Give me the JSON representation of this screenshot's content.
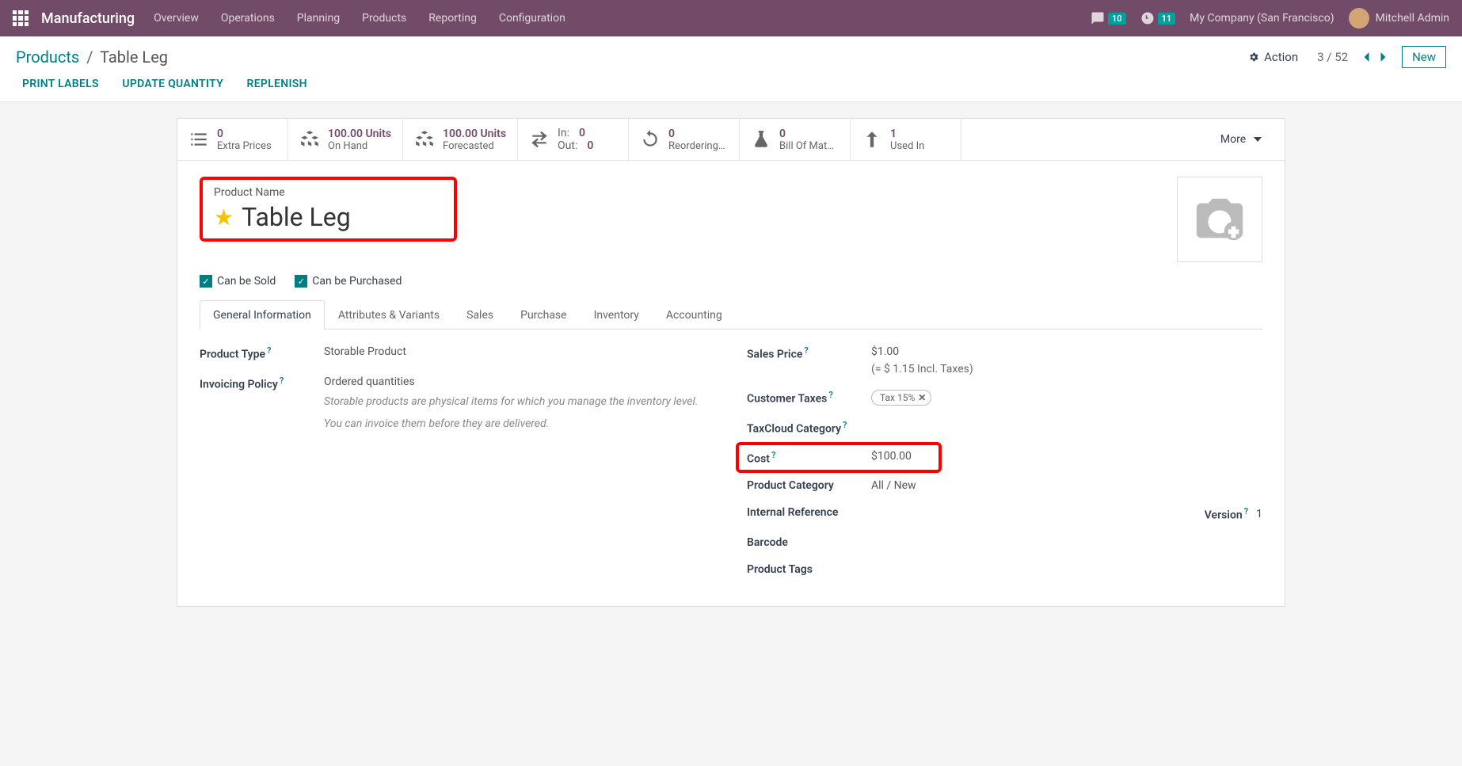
{
  "nav": {
    "brand": "Manufacturing",
    "items": [
      "Overview",
      "Operations",
      "Planning",
      "Products",
      "Reporting",
      "Configuration"
    ],
    "msg_badge": "10",
    "activity_badge": "11",
    "company": "My Company (San Francisco)",
    "user": "Mitchell Admin"
  },
  "breadcrumb": {
    "root": "Products",
    "current": "Table Leg"
  },
  "controls": {
    "action": "Action",
    "pager": "3 / 52",
    "new": "New"
  },
  "action_row": {
    "print": "PRINT LABELS",
    "update": "UPDATE QUANTITY",
    "replenish": "REPLENISH"
  },
  "stats": {
    "extra_prices": {
      "val": "0",
      "lbl": "Extra Prices"
    },
    "on_hand": {
      "val": "100.00 Units",
      "lbl": "On Hand"
    },
    "forecasted": {
      "val": "100.00 Units",
      "lbl": "Forecasted"
    },
    "in_lbl": "In:",
    "in_val": "0",
    "out_lbl": "Out:",
    "out_val": "0",
    "reorder": {
      "val": "0",
      "lbl": "Reordering…"
    },
    "bom": {
      "val": "0",
      "lbl": "Bill Of Mat…"
    },
    "used": {
      "val": "1",
      "lbl": "Used In"
    },
    "more": "More"
  },
  "title": {
    "label": "Product Name",
    "name": "Table Leg"
  },
  "checks": {
    "sold": "Can be Sold",
    "purchased": "Can be Purchased"
  },
  "tabs": [
    "General Information",
    "Attributes & Variants",
    "Sales",
    "Purchase",
    "Inventory",
    "Accounting"
  ],
  "form": {
    "product_type_lbl": "Product Type",
    "product_type_val": "Storable Product",
    "invoicing_lbl": "Invoicing Policy",
    "invoicing_val": "Ordered quantities",
    "hint1": "Storable products are physical items for which you manage the inventory level.",
    "hint2": "You can invoice them before they are delivered.",
    "sales_price_lbl": "Sales Price",
    "sales_price_val": "$1.00",
    "sales_price_sub": "(= $ 1.15 Incl. Taxes)",
    "taxes_lbl": "Customer Taxes",
    "tax_tag": "Tax 15%",
    "taxcloud_lbl": "TaxCloud Category",
    "cost_lbl": "Cost",
    "cost_val": "$100.00",
    "category_lbl": "Product Category",
    "category_val": "All / New",
    "ref_lbl": "Internal Reference",
    "barcode_lbl": "Barcode",
    "tags_lbl": "Product Tags",
    "version_lbl": "Version",
    "version_val": "1"
  }
}
